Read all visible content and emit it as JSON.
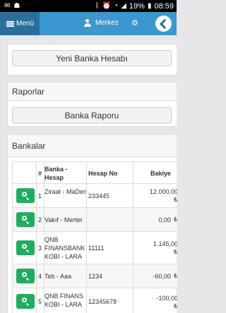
{
  "status_bar": {
    "time": "08:59",
    "battery": "19%"
  },
  "appbar": {
    "menu_label": "Menü",
    "center_label": "Merkez"
  },
  "new_account_button": "Yeni Banka Hesabı",
  "reports": {
    "title": "Raporlar",
    "bank_report_button": "Banka Raporu"
  },
  "banks": {
    "title": "Bankalar",
    "columns": [
      "#",
      "Banka - Hesap",
      "Hesap No",
      "Bakiye"
    ],
    "rows": [
      {
        "no": "1",
        "bank": "Ziraat - MaDen",
        "account_no": "233445",
        "balance": "12.000,00",
        "currency": "₺"
      },
      {
        "no": "2",
        "bank": "Vakıf - Merter",
        "account_no": "",
        "balance": "0,00",
        "currency": "₺"
      },
      {
        "no": "3",
        "bank": "QNB FINANSBANK KOBI - LARA",
        "account_no": "11111",
        "balance": "1.145,00",
        "currency": "₺"
      },
      {
        "no": "4",
        "bank": "Teb - Aaa",
        "account_no": "1234",
        "balance": "-60,00",
        "currency": "₺"
      },
      {
        "no": "5",
        "bank": "QNB FINANS KOBI - LARA",
        "account_no": "12345678",
        "balance": "-100,00",
        "currency": "₺"
      }
    ]
  }
}
